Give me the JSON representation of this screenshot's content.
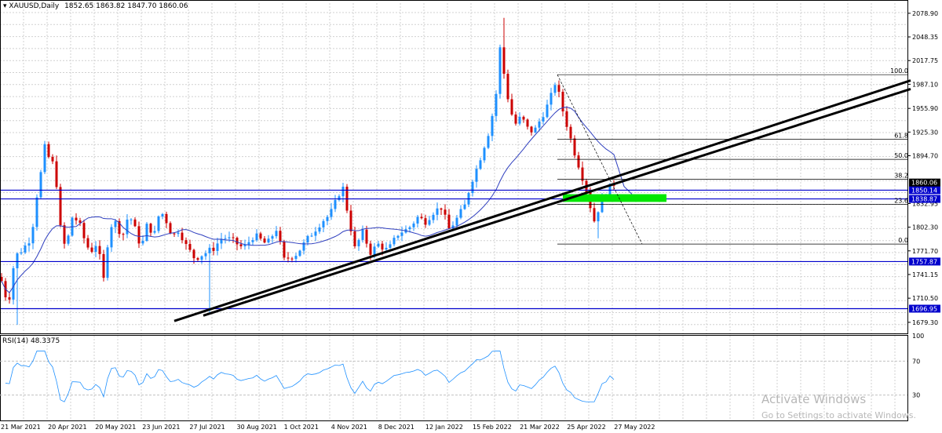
{
  "header": {
    "symbol_label": "XAUUSD,Daily",
    "ohlc_text": "1852.65 1863.82 1847.70 1860.06"
  },
  "rsi_header": "RSI(14) 48.3375",
  "watermark": {
    "line1": "Activate Windows",
    "line2": "Go to Settings to activate Windows."
  },
  "colors": {
    "bull": "#1e90ff",
    "bear": "#cc0000",
    "ma": "#2f3fbf",
    "hline": "#0000cc",
    "trendline": "#000000",
    "zone": "#00e600",
    "fib": "#000000",
    "rsi": "#1e90ff",
    "current_price_bg": "#000000",
    "level_bg": "#0000cc"
  },
  "chart_data": [
    {
      "type": "candlestick",
      "title": "XAUUSD,Daily",
      "ohlc_last": {
        "open": 1852.65,
        "high": 1863.82,
        "low": 1847.7,
        "close": 1860.06
      },
      "x_tick_labels": [
        "21 Mar 2021",
        "20 Apr 2021",
        "20 May 2021",
        "23 Jun 2021",
        "27 Jul 2021",
        "30 Aug 2021",
        "1 Oct 2021",
        "4 Nov 2021",
        "8 Dec 2021",
        "12 Jan 2022",
        "15 Feb 2022",
        "21 Mar 2022",
        "25 Apr 2022",
        "27 May 2022"
      ],
      "y_tick_labels": [
        "2078.90",
        "2048.35",
        "2017.75",
        "1987.10",
        "1955.90",
        "1925.30",
        "1894.70",
        "1832.95",
        "1802.30",
        "1771.70",
        "1741.15",
        "1710.50",
        "1679.30"
      ],
      "ylim": [
        1665,
        2092
      ],
      "current_price": "1860.06",
      "horizontal_levels": [
        "1850.14",
        "1838.87",
        "1757.87",
        "1696.95"
      ],
      "fibonacci": {
        "levels": [
          {
            "label": "100.0",
            "price": 1999.5
          },
          {
            "label": "61.8",
            "price": 1916.0
          },
          {
            "label": "50.0",
            "price": 1890.0
          },
          {
            "label": "38.2",
            "price": 1864.2
          },
          {
            "label": "23.6",
            "price": 1832.0
          },
          {
            "label": "0.0",
            "price": 1780.5
          }
        ]
      },
      "demand_zone": {
        "from": 1835,
        "to": 1845
      },
      "moving_average": "blue line",
      "grid": "on"
    },
    {
      "type": "line",
      "title": "RSI(14) 48.3375",
      "current_value": 48.3375,
      "y_tick_labels": [
        "100",
        "70",
        "30"
      ],
      "ylim": [
        0,
        100
      ]
    }
  ]
}
